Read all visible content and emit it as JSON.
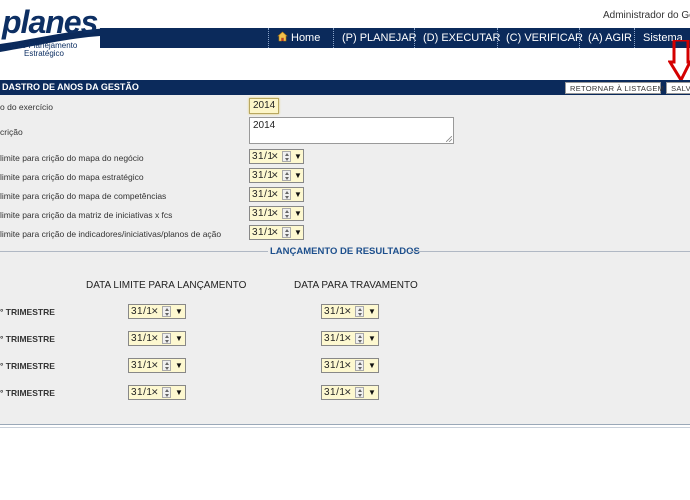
{
  "header": {
    "logo_text": "planes",
    "logo_sub_line1": "o de Planejamento",
    "logo_sub_line2": "Estratégico",
    "admin_text": "Administrador do Gep",
    "nav": [
      {
        "label": "Home",
        "icon": "home-icon"
      },
      {
        "label": "(P) PLANEJAR"
      },
      {
        "label": "(D) EXECUTAR"
      },
      {
        "label": "(C) VERIFICAR"
      },
      {
        "label": "(A) AGIR"
      },
      {
        "label": "Sistema"
      }
    ]
  },
  "section": {
    "title": "DASTRO DE ANOS DA GESTÃO",
    "return_button": "RETORNAR À LISTAGEM",
    "save_button": "SALV"
  },
  "form": {
    "year_label": "o do exercício",
    "year_value": "2014",
    "desc_label": "crição",
    "desc_value": "2014",
    "deadlines": [
      {
        "label": "limite para crição do mapa do negócio",
        "value": "31/1"
      },
      {
        "label": "limite para crição do mapa estratégico",
        "value": "31/1"
      },
      {
        "label": "limite para crição do mapa de competências",
        "value": "31/1"
      },
      {
        "label": "limite para crição da matriz de iniciativas x fcs",
        "value": "31/1"
      },
      {
        "label": "limite para crição de indicadores/iniciativas/planos de ação",
        "value": "31/1"
      }
    ]
  },
  "results": {
    "legend": "LANÇAMENTO DE RESULTADOS",
    "col_launch": "DATA LIMITE PARA LANÇAMENTO",
    "col_lock": "DATA PARA TRAVAMENTO",
    "rows": [
      {
        "label": "° TRIMESTRE",
        "launch": "31/1",
        "lock": "31/1"
      },
      {
        "label": "° TRIMESTRE",
        "launch": "31/1",
        "lock": "31/1"
      },
      {
        "label": "° TRIMESTRE",
        "launch": "31/1",
        "lock": "31/1"
      },
      {
        "label": "° TRIMESTRE",
        "launch": "31/1",
        "lock": "31/1"
      }
    ]
  },
  "colors": {
    "navy": "#0b2a5b",
    "field_yellow": "#fdf8d0",
    "legend_blue": "#1d4f8c",
    "arrow_red": "#d40000"
  }
}
